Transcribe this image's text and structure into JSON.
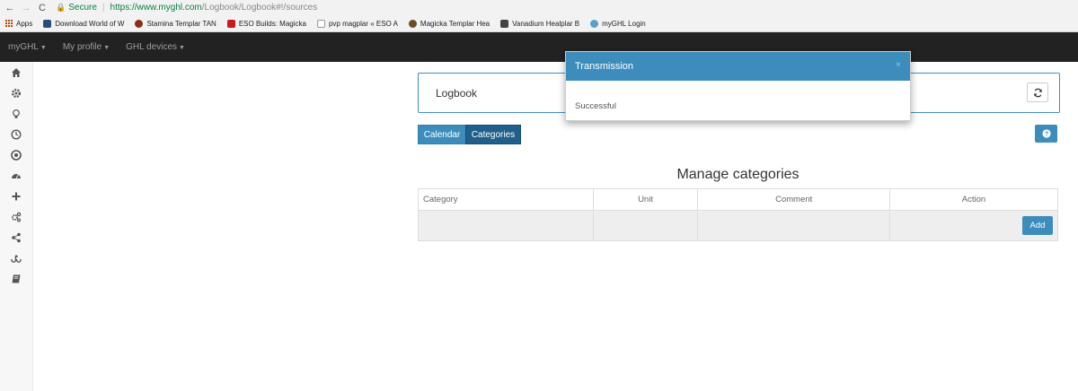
{
  "browser": {
    "back": "←",
    "forward": "→",
    "reload": "C",
    "secure_label": "Secure",
    "url_main": "https://www.myghl.com",
    "url_rest": "/Logbook/Logbook#!/sources"
  },
  "bookmarks": [
    {
      "label": "Apps",
      "color": "#c2410c"
    },
    {
      "label": "Download World of W",
      "color": "#2b4d7c"
    },
    {
      "label": "Stamina Templar TAN",
      "color": "#8b2e1a"
    },
    {
      "label": "ESO Builds: Magicka",
      "color": "#cc181e"
    },
    {
      "label": "pvp magplar « ESO A",
      "color": "#999999"
    },
    {
      "label": "Magicka Templar Hea",
      "color": "#6b4b2a"
    },
    {
      "label": "Vanadium Healplar B",
      "color": "#444444"
    },
    {
      "label": "myGHL Login",
      "color": "#5aa0c8"
    }
  ],
  "navbar": {
    "items": [
      "myGHL",
      "My profile",
      "GHL devices"
    ]
  },
  "sidebar": {
    "icons": [
      "home-icon",
      "gear-icon",
      "lightbulb-icon",
      "clock-icon",
      "chrome-icon",
      "dashboard-icon",
      "plus-icon",
      "cogs-icon",
      "share-icon",
      "stumbleupon-icon",
      "book-icon"
    ]
  },
  "logbook": {
    "title": "Logbook"
  },
  "tabs": {
    "calendar": "Calendar",
    "categories": "Categories"
  },
  "help": {
    "icon": "question-icon"
  },
  "section": {
    "title": "Manage categories",
    "columns": [
      "Category",
      "Unit",
      "Comment",
      "Action"
    ],
    "add_label": "Add"
  },
  "modal": {
    "title": "Transmission",
    "close": "×",
    "message": "Successful"
  },
  "colors": {
    "primary": "#3c8dbc",
    "active_tab": "#1f5f8a",
    "navbar": "#222222"
  }
}
